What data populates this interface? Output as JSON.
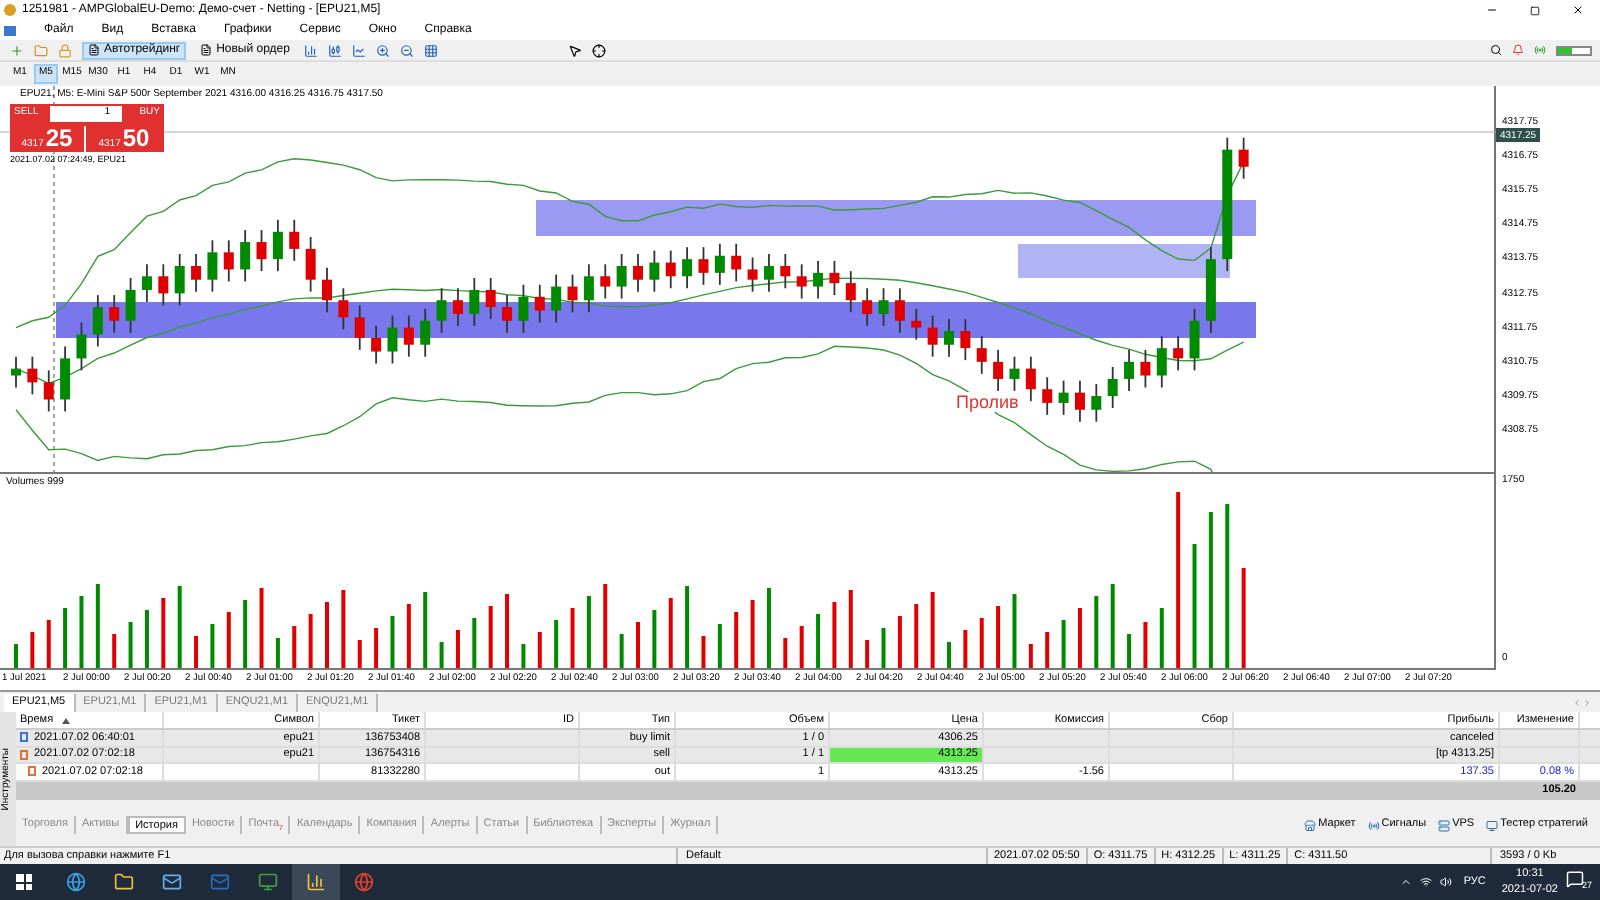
{
  "window": {
    "title": "1251981 - AMPGlobalEU-Demo: Демо-счет - Netting - [EPU21,M5]"
  },
  "menu": [
    "Файл",
    "Вид",
    "Вставка",
    "Графики",
    "Сервис",
    "Окно",
    "Справка"
  ],
  "toolbar": {
    "buttons": [
      {
        "label": "Автотрейдинг",
        "selected": true
      },
      {
        "label": "Новый ордер",
        "selected": false
      }
    ]
  },
  "timeframes": [
    {
      "label": "M1",
      "selected": false
    },
    {
      "label": "M5",
      "selected": true
    },
    {
      "label": "M15",
      "selected": false
    },
    {
      "label": "M30",
      "selected": false
    },
    {
      "label": "H1",
      "selected": false
    },
    {
      "label": "H4",
      "selected": false
    },
    {
      "label": "D1",
      "selected": false
    },
    {
      "label": "W1",
      "selected": false
    },
    {
      "label": "MN",
      "selected": false
    }
  ],
  "chart": {
    "title": "EPU21, M5: E-Mini S&P 500r September 2021 4316.00 4316.25 4316.75 4317.50",
    "trade_panel": {
      "sell_label": "SELL",
      "volume": "1",
      "buy_label": "BUY",
      "sell_price_small": "4317",
      "sell_price_big": "25",
      "buy_price_small": "4317",
      "buy_price_big": "50"
    },
    "timestamp": "2021.07.02 07:24:49, EPU21",
    "annotation": "Пролив",
    "price_axis": [
      "4317.75",
      "4316.75",
      "4315.75",
      "4314.75",
      "4313.75",
      "4312.75",
      "4311.75",
      "4310.75",
      "4309.75",
      "4308.75"
    ],
    "current_price": "4317.25",
    "volume_title": "Volumes 999",
    "volume_axis": [
      "1750",
      "0"
    ],
    "time_axis": [
      "1 Jul 2021",
      "2 Jul 00:00",
      "2 Jul 00:20",
      "2 Jul 00:40",
      "2 Jul 01:00",
      "2 Jul 01:20",
      "2 Jul 01:40",
      "2 Jul 02:00",
      "2 Jul 02:20",
      "2 Jul 02:40",
      "2 Jul 03:00",
      "2 Jul 03:20",
      "2 Jul 03:40",
      "2 Jul 04:00",
      "2 Jul 04:20",
      "2 Jul 04:40",
      "2 Jul 05:00",
      "2 Jul 05:20",
      "2 Jul 05:40",
      "2 Jul 06:00",
      "2 Jul 06:20",
      "2 Jul 06:40",
      "2 Jul 07:00",
      "2 Jul 07:20"
    ]
  },
  "chart_tabs": [
    {
      "label": "EPU21,M5",
      "selected": true
    },
    {
      "label": "EPU21,M1",
      "selected": false
    },
    {
      "label": "EPU21,M1",
      "selected": false
    },
    {
      "label": "ENQU21,M1",
      "selected": false
    },
    {
      "label": "ENQU21,M1",
      "selected": false
    }
  ],
  "history_table": {
    "columns": [
      "Время",
      "Символ",
      "Тикет",
      "ID",
      "Тип",
      "Объем",
      "Цена",
      "Комиссия",
      "Сбор",
      "Прибыль",
      "Изменение"
    ],
    "rows": [
      {
        "kind": "order",
        "cells": [
          "2021.07.02 06:40:01",
          "epu21",
          "136753408",
          "",
          "buy limit",
          "1 / 0",
          "4306.25",
          "",
          "",
          "canceled",
          ""
        ],
        "price_flash": false
      },
      {
        "kind": "position",
        "cells": [
          "2021.07.02 07:02:18",
          "epu21",
          "136754316",
          "",
          "sell",
          "1 / 1",
          "4313.25",
          "",
          "",
          "[tp 4313.25]",
          ""
        ],
        "price_flash": true
      },
      {
        "kind": "deal",
        "cells": [
          "2021.07.02 07:02:18",
          "",
          "81332280",
          "",
          "out",
          "1",
          "4313.25",
          "-1.56",
          "",
          "137.35",
          "0.08 %"
        ],
        "price_flash": false
      }
    ],
    "total_profit": "105.20"
  },
  "side_label": "Инструменты",
  "toolbox_tabs": [
    {
      "label": "Торговля",
      "selected": false
    },
    {
      "label": "Активы",
      "selected": false
    },
    {
      "label": "История",
      "selected": true
    },
    {
      "label": "Новости",
      "selected": false
    },
    {
      "label": "Почта",
      "selected": false,
      "badge": "7"
    },
    {
      "label": "Календарь",
      "selected": false
    },
    {
      "label": "Компания",
      "selected": false
    },
    {
      "label": "Алерты",
      "selected": false
    },
    {
      "label": "Статьи",
      "selected": false
    },
    {
      "label": "Библиотека",
      "selected": false
    },
    {
      "label": "Эксперты",
      "selected": false
    },
    {
      "label": "Журнал",
      "selected": false
    }
  ],
  "service_buttons": [
    "Маркет",
    "Сигналы",
    "VPS",
    "Тестер стратегий"
  ],
  "status_bar": {
    "help": "Для вызова справки нажмите F1",
    "profile": "Default",
    "fields": [
      "2021.07.02 05:50",
      "O: 4311.75",
      "H: 4312.25",
      "L: 4311.25",
      "C: 4311.50"
    ],
    "traffic": "3593 / 0 Kb"
  },
  "taskbar": {
    "language": "РУС",
    "time": "10:31",
    "date": "2021-07-02",
    "notifications": "27"
  }
}
